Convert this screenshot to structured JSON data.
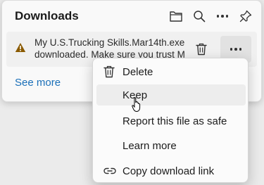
{
  "panel": {
    "title": "Downloads",
    "icons": [
      "folder-icon",
      "search-icon",
      "more-options-icon",
      "pin-icon"
    ]
  },
  "download_item": {
    "status_icon": "warning-icon",
    "message_line1": "My U.S.Trucking Skills.Mar14th.exe isn't",
    "message_line2": "downloaded. Make sure you trust My U",
    "action_icons": [
      "trash-icon",
      "more-actions-icon"
    ]
  },
  "see_more_label": "See more",
  "context_menu": {
    "items": [
      {
        "label": "Delete",
        "icon": "trash-icon"
      },
      {
        "label": "Keep",
        "icon": ""
      },
      {
        "label": "Report this file as safe",
        "icon": ""
      },
      {
        "label": "Learn more",
        "icon": ""
      },
      {
        "label": "Copy download link",
        "icon": "link-icon"
      }
    ],
    "hovered_item": "Keep"
  },
  "colors": {
    "link": "#1a6fb8",
    "warning": "#8a5a00",
    "panel_bg": "#f9f9f9",
    "menu_bg": "#fbfbfb",
    "hover_bg": "#ededed"
  }
}
